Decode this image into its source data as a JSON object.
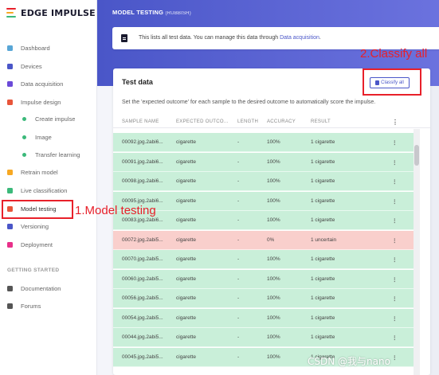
{
  "app": {
    "logo_text": "EDGE IMPULSE",
    "logo_colors": [
      "#e8202a",
      "#f7a823",
      "#3bb97a"
    ]
  },
  "sidebar": {
    "items": [
      {
        "label": "Dashboard",
        "icon": "monitor-icon",
        "color": "#58a6d6"
      },
      {
        "label": "Devices",
        "icon": "devices-icon",
        "color": "#4a56c8"
      },
      {
        "label": "Data acquisition",
        "icon": "database-icon",
        "color": "#6b4ad8"
      },
      {
        "label": "Impulse design",
        "icon": "pulse-icon",
        "color": "#e8553a"
      },
      {
        "label": "Create impulse",
        "icon": "dot-icon",
        "color": "#3bb97a",
        "sub": true
      },
      {
        "label": "Image",
        "icon": "dot-icon",
        "color": "#3bb97a",
        "sub": true
      },
      {
        "label": "Transfer learning",
        "icon": "dot-icon",
        "color": "#3bb97a",
        "sub": true
      },
      {
        "label": "Retrain model",
        "icon": "retrain-icon",
        "color": "#f7a823"
      },
      {
        "label": "Live classification",
        "icon": "live-icon",
        "color": "#3bb97a"
      },
      {
        "label": "Model testing",
        "icon": "clipboard-icon",
        "color": "#e8553a",
        "active": true
      },
      {
        "label": "Versioning",
        "icon": "versioning-icon",
        "color": "#4a56c8"
      },
      {
        "label": "Deployment",
        "icon": "deployment-icon",
        "color": "#e8308a"
      }
    ],
    "section_label": "GETTING STARTED",
    "getting_started": [
      {
        "label": "Documentation",
        "icon": "book-icon",
        "color": "#555"
      },
      {
        "label": "Forums",
        "icon": "chat-icon",
        "color": "#555"
      }
    ]
  },
  "header": {
    "title": "MODEL TESTING",
    "subtitle": "(RUBBISH)",
    "info_text": "This lists all test data. You can manage this data through ",
    "info_link": "Data acquisition",
    "info_suffix": "."
  },
  "annotations": {
    "classify": "2.Classify all",
    "model_testing": "1.Model testing"
  },
  "test_data": {
    "title": "Test data",
    "classify_button": "Classify all",
    "description": "Set the 'expected outcome' for each sample to the desired outcome to automatically score the impulse.",
    "columns": [
      "SAMPLE NAME",
      "EXPECTED OUTCO...",
      "LENGTH",
      "ACCURACY",
      "RESULT"
    ],
    "rows": [
      {
        "name": "00092.jpg.2abi6...",
        "expected": "cigarette",
        "length": "-",
        "accuracy": "100%",
        "result": "1 cigarette",
        "status": "ok"
      },
      {
        "name": "00091.jpg.2abi6...",
        "expected": "cigarette",
        "length": "-",
        "accuracy": "100%",
        "result": "1 cigarette",
        "status": "ok"
      },
      {
        "name": "00098.jpg.2abi6...",
        "expected": "cigarette",
        "length": "-",
        "accuracy": "100%",
        "result": "1 cigarette",
        "status": "ok"
      },
      {
        "name": "00095.jpg.2abi6...",
        "expected": "cigarette",
        "length": "-",
        "accuracy": "100%",
        "result": "1 cigarette",
        "status": "ok"
      },
      {
        "name": "00083.jpg.2abi6...",
        "expected": "cigarette",
        "length": "-",
        "accuracy": "100%",
        "result": "1 cigarette",
        "status": "ok"
      },
      {
        "name": "00072.jpg.2abi5...",
        "expected": "cigarette",
        "length": "-",
        "accuracy": "0%",
        "result": "1 uncertain",
        "status": "bad"
      },
      {
        "name": "00070.jpg.2abi5...",
        "expected": "cigarette",
        "length": "-",
        "accuracy": "100%",
        "result": "1 cigarette",
        "status": "ok"
      },
      {
        "name": "00060.jpg.2abi5...",
        "expected": "cigarette",
        "length": "-",
        "accuracy": "100%",
        "result": "1 cigarette",
        "status": "ok"
      },
      {
        "name": "00056.jpg.2abi5...",
        "expected": "cigarette",
        "length": "-",
        "accuracy": "100%",
        "result": "1 cigarette",
        "status": "ok"
      },
      {
        "name": "00054.jpg.2abi5...",
        "expected": "cigarette",
        "length": "-",
        "accuracy": "100%",
        "result": "1 cigarette",
        "status": "ok"
      },
      {
        "name": "00044.jpg.2abi5...",
        "expected": "cigarette",
        "length": "-",
        "accuracy": "100%",
        "result": "1 cigarette",
        "status": "ok"
      },
      {
        "name": "00045.jpg.2abi5...",
        "expected": "cigarette",
        "length": "-",
        "accuracy": "100%",
        "result": "1 cigarette",
        "status": "ok"
      }
    ],
    "row_menu": "⋮"
  },
  "watermark": "CSDN @我与nano"
}
